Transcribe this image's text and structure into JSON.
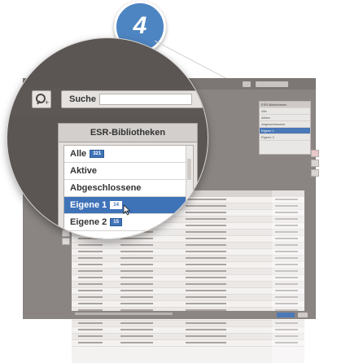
{
  "step_badge": "4",
  "search": {
    "label": "Suche",
    "go_icon": "chevron-right-icon"
  },
  "library": {
    "title": "ESR-Bibliotheken",
    "items": [
      {
        "label": "Alle",
        "badge": "321"
      },
      {
        "label": "Aktive",
        "badge": ""
      },
      {
        "label": "Abgeschlossene",
        "badge": ""
      },
      {
        "label": "Eigene 1",
        "badge": "14",
        "selected": true
      },
      {
        "label": "Eigene 2",
        "badge": "15"
      }
    ]
  },
  "mini_panel": {
    "title": "ESR-Bibliotheken",
    "items": [
      "Alle",
      "Aktive",
      "Abgeschlossene",
      "Eigene 1",
      "Eigene 2"
    ]
  },
  "colors": {
    "accent": "#3f73b8",
    "step_badge": "#4d85c2",
    "app_bg": "#8a8583"
  }
}
